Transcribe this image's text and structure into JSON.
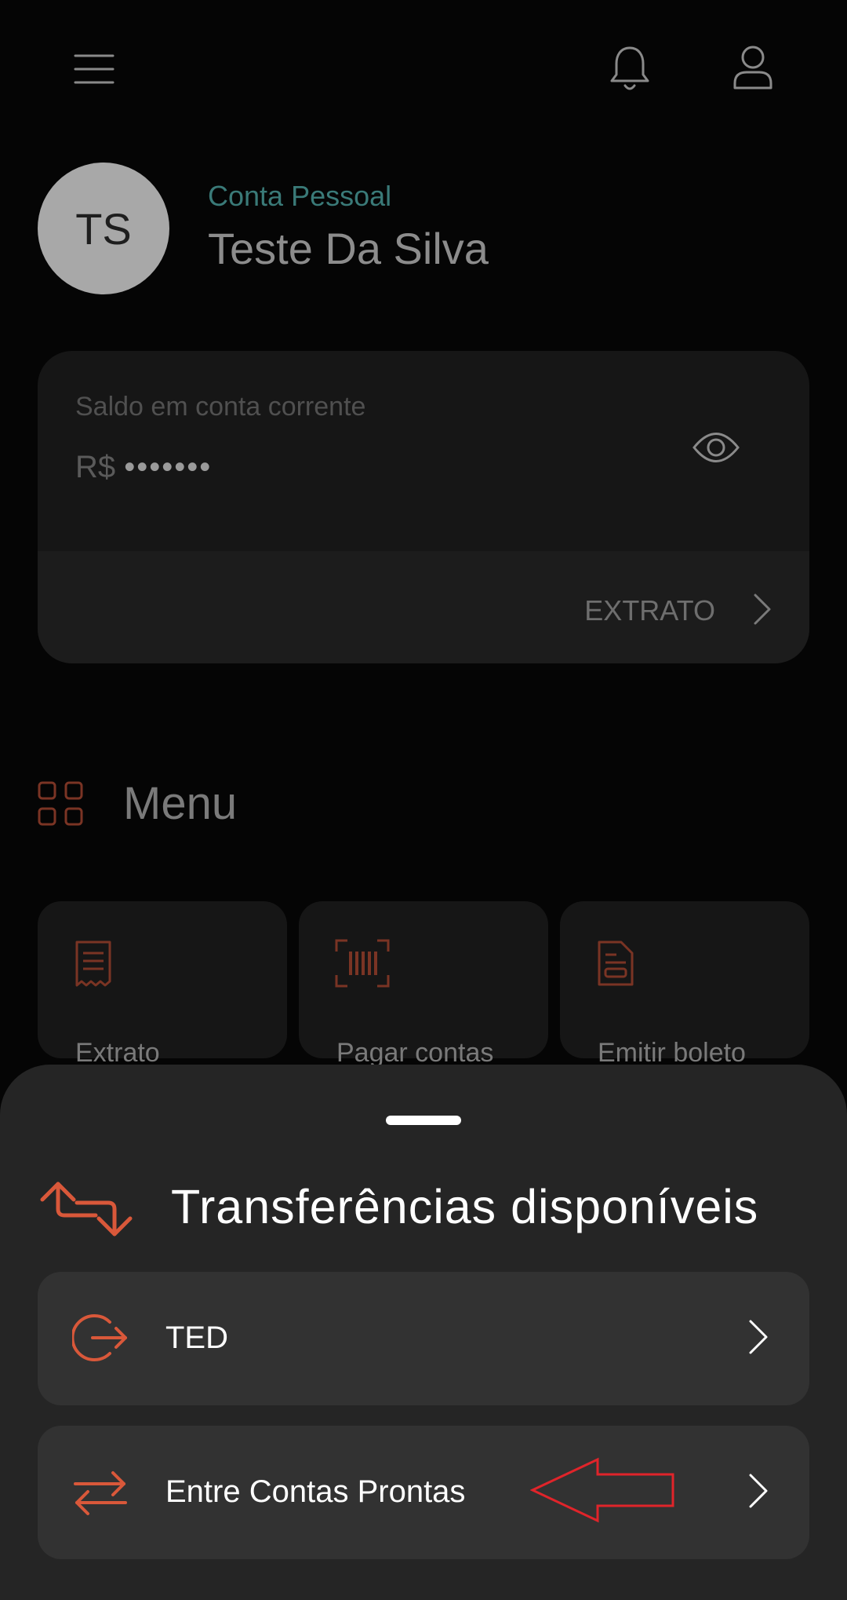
{
  "header": {
    "menu_icon": "hamburger-icon",
    "notification_icon": "bell-icon",
    "profile_icon": "user-icon"
  },
  "account": {
    "initials": "TS",
    "type": "Conta Pessoal",
    "name": "Teste Da Silva"
  },
  "balance": {
    "label": "Saldo em conta corrente",
    "currency": "R$",
    "masked_value": "•••••••",
    "statement_link": "EXTRATO"
  },
  "menu": {
    "title": "Menu",
    "items": [
      {
        "label": "Extrato",
        "icon": "receipt-icon"
      },
      {
        "label": "Pagar contas",
        "icon": "barcode-icon"
      },
      {
        "label": "Emitir boleto",
        "icon": "document-icon"
      }
    ]
  },
  "sheet": {
    "title": "Transferências disponíveis",
    "options": [
      {
        "label": "TED",
        "icon": "logout-arrow-icon"
      },
      {
        "label": "Entre Contas Prontas",
        "icon": "swap-arrows-icon"
      }
    ]
  },
  "colors": {
    "accent": "#d9583a",
    "teal": "#3a7a78",
    "annotation": "#e0242a"
  }
}
